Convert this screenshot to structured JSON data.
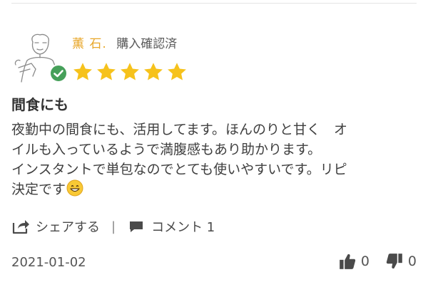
{
  "review": {
    "reviewer_name": "薫 石.",
    "purchase_badge": "購入確認済",
    "rating": 5,
    "rating_max": 5,
    "title": "間食にも",
    "body_lines": [
      "夜勤中の間食にも、活用してます。ほんのりと甘く　オ",
      "イルも入っているようで満腹感もあり助かります。",
      "インスタントで単包なのでとても使いやすいです。リピ",
      "決定です"
    ],
    "body_emoji": "grinning-face",
    "date": "2021-01-02"
  },
  "actions": {
    "share_label": "シェアする",
    "separator": "|",
    "comment_label": "コメント 1"
  },
  "votes": {
    "helpful_count": "0",
    "unhelpful_count": "0"
  },
  "colors": {
    "star": "#f6c21c",
    "reviewer_name": "#e8a72a",
    "verified_badge": "#46a05a",
    "text": "#3f3f3f",
    "icon": "#4a4a4a"
  }
}
